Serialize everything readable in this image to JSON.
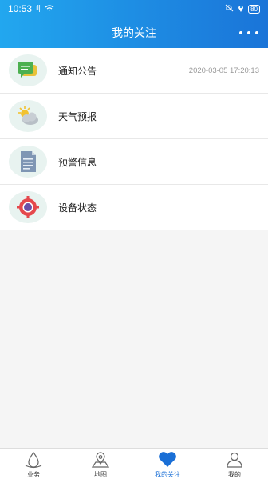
{
  "status_bar": {
    "time": "10:53",
    "signal": "ıl|l",
    "battery": "80"
  },
  "header": {
    "title": "我的关注"
  },
  "list": {
    "items": [
      {
        "label": "通知公告",
        "time": "2020-03-05 17:20:13",
        "icon": "message-icon"
      },
      {
        "label": "天气预报",
        "time": "",
        "icon": "weather-icon"
      },
      {
        "label": "预警信息",
        "time": "",
        "icon": "document-icon"
      },
      {
        "label": "设备状态",
        "time": "",
        "icon": "device-target-icon"
      }
    ]
  },
  "tabbar": {
    "tabs": [
      {
        "label": "业务",
        "icon": "droplet-icon"
      },
      {
        "label": "地图",
        "icon": "map-pin-icon"
      },
      {
        "label": "我的关注",
        "icon": "heart-icon"
      },
      {
        "label": "我的",
        "icon": "user-icon"
      }
    ]
  },
  "colors": {
    "header_start": "#22a7ef",
    "header_end": "#1a74d8",
    "active_tab": "#1a6fd6"
  }
}
